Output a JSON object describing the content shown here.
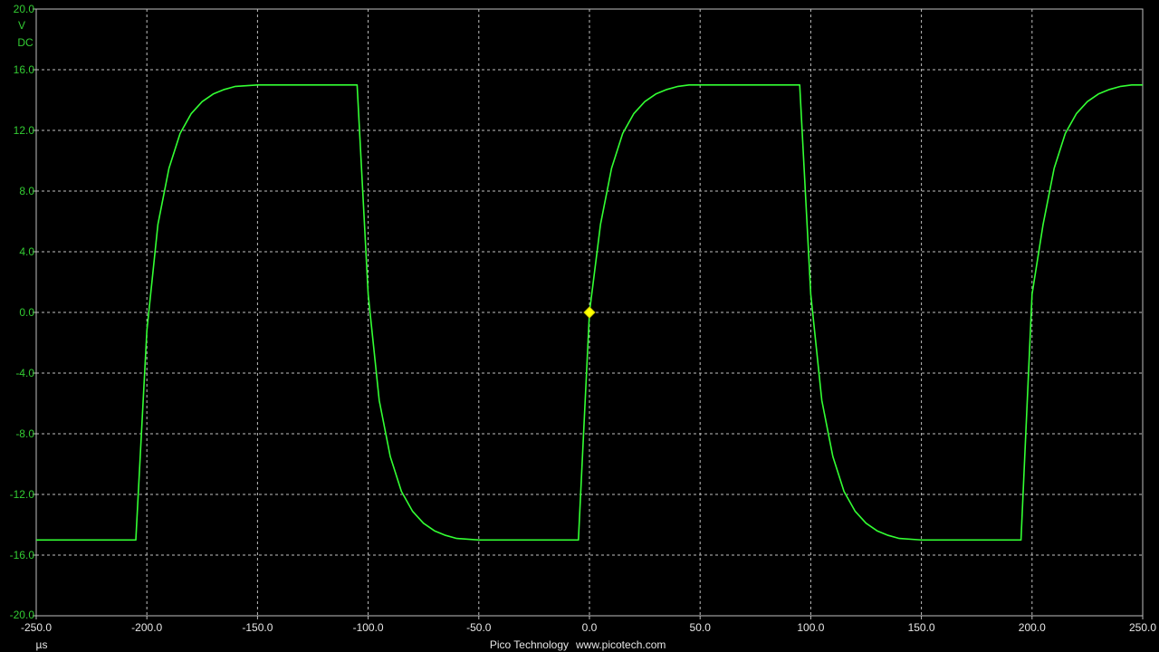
{
  "chart_data": {
    "type": "line",
    "x_unit": "µs",
    "y_unit": "V",
    "coupling": "DC",
    "xlim": [
      -250,
      250
    ],
    "ylim": [
      -20,
      20
    ],
    "x_ticks": [
      "-250.0",
      "-200.0",
      "-150.0",
      "-100.0",
      "-50.0",
      "0.0",
      "50.0",
      "100.0",
      "150.0",
      "200.0",
      "250.0"
    ],
    "y_ticks": [
      "20.0",
      "16.0",
      "12.0",
      "8.0",
      "4.0",
      "0.0",
      "-4.0",
      "-8.0",
      "-12.0",
      "-16.0",
      "-20.0"
    ],
    "grid": true,
    "trace_color": "#33ff33",
    "series": [
      {
        "x": [
          -250,
          -205,
          -200,
          -195,
          -190,
          -185,
          -180,
          -175,
          -170,
          -165,
          -160,
          -150,
          -140,
          -130,
          -120,
          -110,
          -105,
          -100,
          -95,
          -90,
          -85,
          -80,
          -75,
          -70,
          -65,
          -60,
          -50,
          -40,
          -30,
          -20,
          -10,
          -5,
          0,
          5,
          10,
          15,
          20,
          25,
          30,
          35,
          40,
          45,
          50,
          60,
          70,
          80,
          90,
          95,
          100,
          105,
          110,
          115,
          120,
          125,
          130,
          135,
          140,
          150,
          160,
          170,
          180,
          190,
          195,
          200,
          205,
          210,
          215,
          220,
          225,
          230,
          235,
          240,
          245,
          250
        ],
        "y": [
          -15.0,
          -15.0,
          -1.2,
          5.8,
          9.5,
          11.8,
          13.1,
          13.9,
          14.4,
          14.7,
          14.9,
          15.0,
          15.0,
          15.0,
          15.0,
          15.0,
          15.0,
          1.2,
          -5.8,
          -9.5,
          -11.8,
          -13.1,
          -13.9,
          -14.4,
          -14.7,
          -14.9,
          -15.0,
          -15.0,
          -15.0,
          -15.0,
          -15.0,
          -15.0,
          0.0,
          5.8,
          9.5,
          11.8,
          13.1,
          13.9,
          14.4,
          14.7,
          14.9,
          15.0,
          15.0,
          15.0,
          15.0,
          15.0,
          15.0,
          15.0,
          1.2,
          -5.8,
          -9.5,
          -11.8,
          -13.1,
          -13.9,
          -14.4,
          -14.7,
          -14.9,
          -15.0,
          -15.0,
          -15.0,
          -15.0,
          -15.0,
          -15.0,
          1.2,
          5.8,
          9.5,
          11.8,
          13.1,
          13.9,
          14.4,
          14.7,
          14.9,
          15.0,
          15.0
        ]
      }
    ],
    "trigger": {
      "x": 0.0,
      "y": 0.0,
      "color": "#ffff00"
    }
  },
  "footer": {
    "company": "Pico Technology",
    "website": "www.picotech.com"
  },
  "colors": {
    "background": "#000000",
    "grid": "#bfbfbf",
    "labels": "#33cc33",
    "axis_frame": "#bfbfbf",
    "footer_text": "#e6e6e6"
  }
}
